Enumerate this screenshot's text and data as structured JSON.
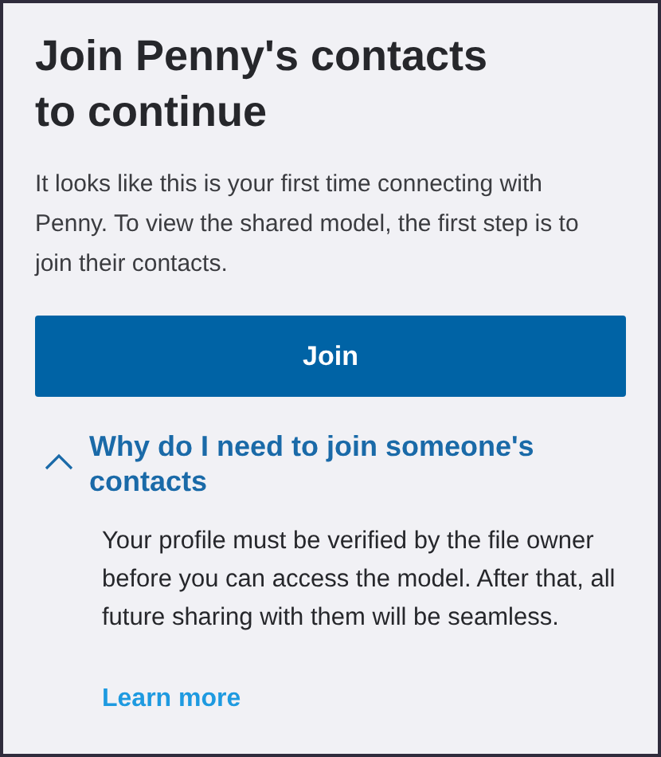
{
  "title": "Join Penny's contacts to continue",
  "intro": "It looks like this is your first time connecting with Penny. To view the shared model, the first step is to join their contacts.",
  "join_button": "Join",
  "faq": {
    "question": "Why do I need to join someone's contacts",
    "expanded": true,
    "answer": "Your profile must be verified by the file owner before you can access the model. After that, all future sharing with them will be seamless.",
    "link": "Learn more"
  }
}
